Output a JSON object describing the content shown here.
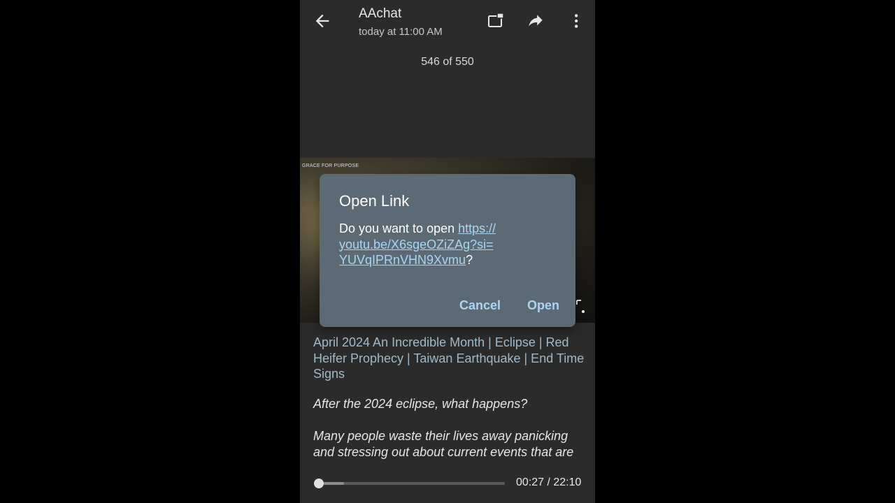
{
  "header": {
    "title": "AAchat",
    "subtitle": "today at 11:00 AM"
  },
  "counter": "546 of 550",
  "media": {
    "caption": "GRACE FOR PURPOSE",
    "logo_text": "GRACE FOR"
  },
  "dialog": {
    "title": "Open Link",
    "prompt": "Do you want to open ",
    "link_line1": "https://",
    "link_line2": "youtu.be/X6sgeOZiZAg?si=",
    "link_line3": "YUVqIPRnVHN9Xvmu",
    "suffix": "?",
    "cancel_label": "Cancel",
    "open_label": "Open"
  },
  "description": {
    "video_title": "April 2024 An Incredible Month | Eclipse | Red Heifer Prophecy | Taiwan Earthquake | End Time Signs",
    "question": "After the 2024 eclipse, what happens?",
    "paragraph": "Many people waste their lives away panicking and stressing out about current events that are"
  },
  "player": {
    "time": "00:27 / 22:10",
    "progress_fraction": 0.02,
    "buffered_fraction": 0.15
  },
  "colors": {
    "background": "#2b2b2b",
    "dialog": "#5b6a74",
    "accent_link": "#a9d6f2",
    "video_title": "#9fb9c9"
  },
  "icons": [
    "arrow-back-icon",
    "share-screen-icon",
    "forward-icon",
    "more-vert-icon"
  ]
}
